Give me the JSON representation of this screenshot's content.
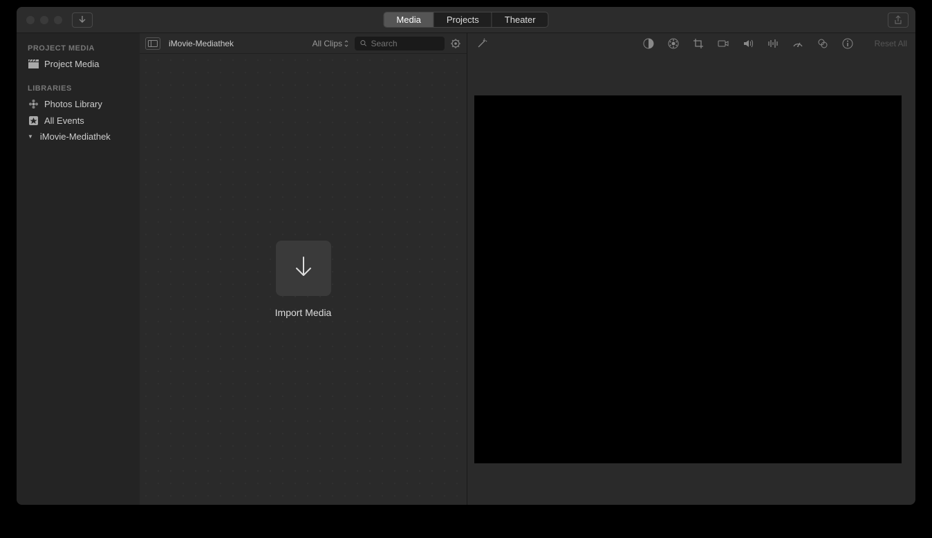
{
  "titlebar": {
    "tabs": [
      "Media",
      "Projects",
      "Theater"
    ],
    "active_tab": 0
  },
  "sidebar": {
    "section1_title": "PROJECT MEDIA",
    "project_media": "Project Media",
    "section2_title": "LIBRARIES",
    "photos_library": "Photos Library",
    "all_events": "All Events",
    "imovie_mediathek": "iMovie-Mediathek"
  },
  "browser": {
    "title": "iMovie-Mediathek",
    "filter_label": "All Clips",
    "search_placeholder": "Search",
    "import_label": "Import Media"
  },
  "viewer": {
    "reset_label": "Reset All"
  }
}
